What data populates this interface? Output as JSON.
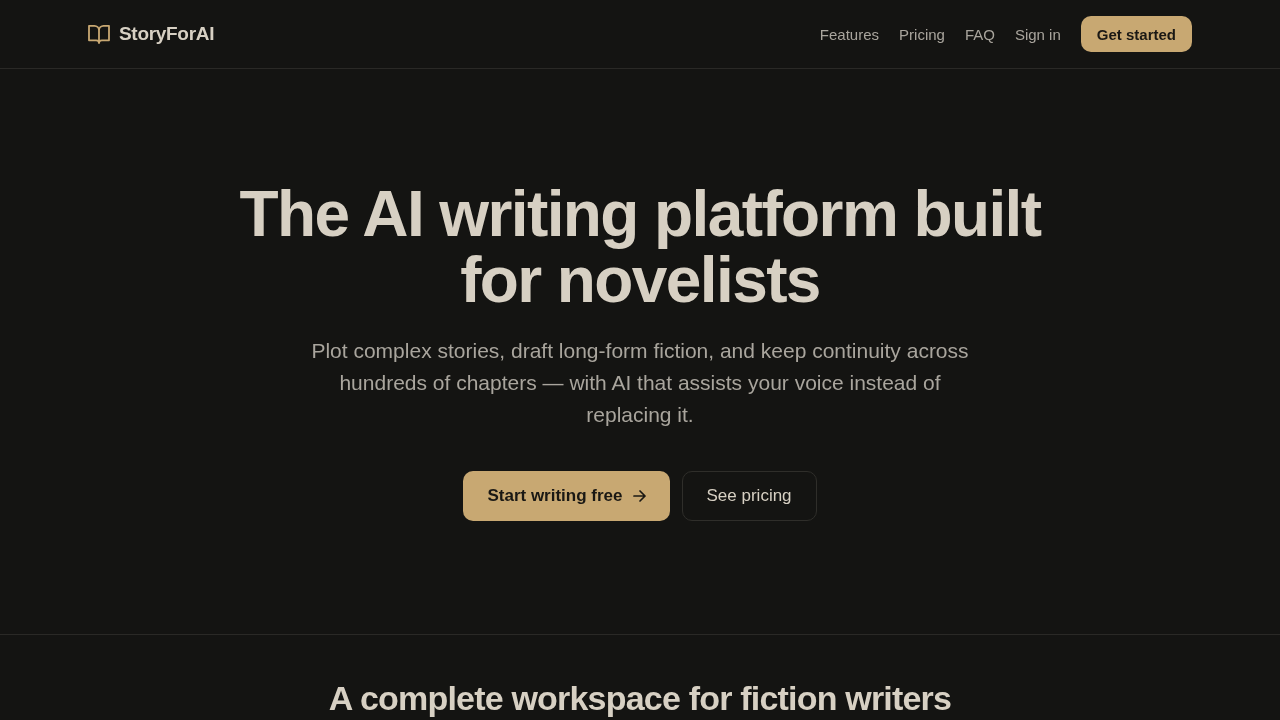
{
  "nav": {
    "brand": "StoryForAI",
    "links": [
      {
        "label": "Features"
      },
      {
        "label": "Pricing"
      },
      {
        "label": "FAQ"
      },
      {
        "label": "Sign in"
      }
    ],
    "cta": "Get started"
  },
  "hero": {
    "title": "The AI writing platform built for novelists",
    "subtitle": "Plot complex stories, draft long-form fiction, and keep continuity across hundreds of chapters — with AI that assists your voice instead of replacing it.",
    "buttons": [
      {
        "label": "Start writing free",
        "kind": "primary"
      },
      {
        "label": "See pricing",
        "kind": "secondary"
      }
    ]
  },
  "features": {
    "heading": "A complete workspace for fiction writers"
  }
}
